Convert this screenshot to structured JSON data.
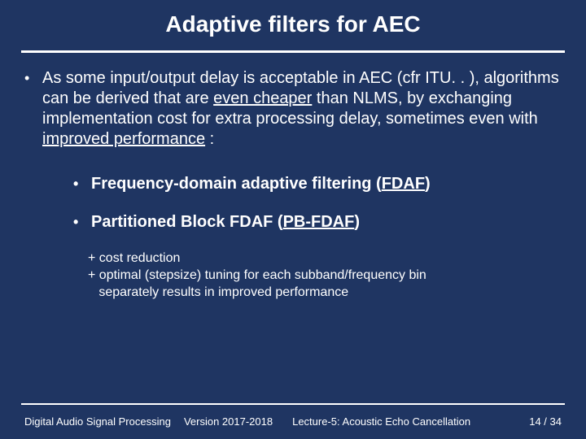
{
  "title": "Adaptive filters for AEC",
  "main": {
    "para_pre": "As some input/output delay is acceptable in AEC (cfr ITU. . ), algorithms can be derived that are ",
    "para_u1": "even cheaper",
    "para_mid1": " than NLMS, by exchanging implementation cost for extra processing delay, sometimes even with ",
    "para_u2": "improved performance",
    "para_post": " :"
  },
  "sub": {
    "item1_pre": "Frequency-domain adaptive filtering (",
    "item1_u": "FDAF",
    "item1_post": ")",
    "item2_pre": "Partitioned Block FDAF (",
    "item2_u": "PB-FDAF",
    "item2_post": ")"
  },
  "notes": {
    "n1": "+ cost reduction",
    "n2": "+ optimal (stepsize) tuning for each subband/frequency bin",
    "n3_indent": "   separately results in improved performance"
  },
  "footer": {
    "left": "Digital Audio Signal Processing",
    "version": "Version 2017-2018",
    "lecture": "Lecture-5: Acoustic Echo Cancellation",
    "page": "14 / 34"
  }
}
